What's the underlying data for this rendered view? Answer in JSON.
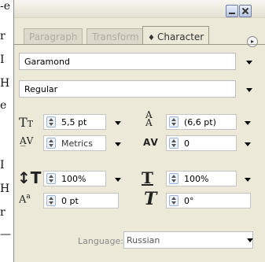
{
  "panel": {
    "tabs": [
      {
        "label": "Paragraph",
        "active": false
      },
      {
        "label": "Transform",
        "active": false
      },
      {
        "label": "Character",
        "active": true,
        "icon": "double-arrow-icon"
      }
    ],
    "font_family": "Garamond",
    "font_style": "Regular",
    "font_size": "5,5 pt",
    "leading": "(6,6 pt)",
    "kerning": "Metrics",
    "tracking": "0",
    "vertical_scale": "100%",
    "horizontal_scale": "100%",
    "baseline_shift": "0 pt",
    "skew": "0°",
    "language_label": "Language:",
    "language": "Russian"
  },
  "colors": {
    "panel_bg": "#ece9d8",
    "tab_inactive_text": "#b0ad9f",
    "label_gray": "#8a8a8a"
  }
}
